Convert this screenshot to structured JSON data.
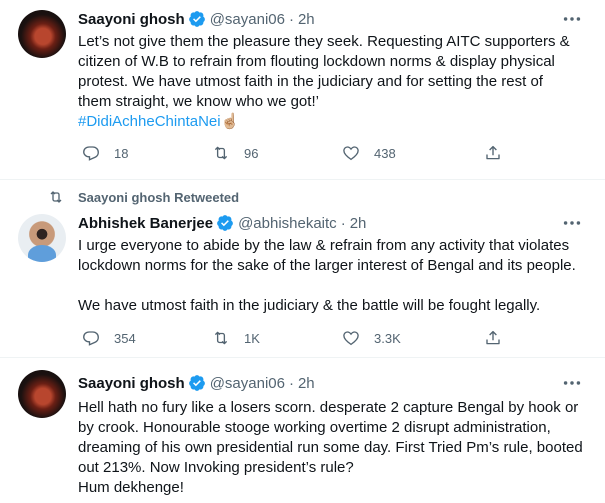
{
  "tweets": [
    {
      "name": "Saayoni ghosh",
      "handle": "@sayani06",
      "time": "2h",
      "lines": [
        "Let’s not give them the pleasure they seek. Requesting AITC supporters &",
        "citizen of W.B to refrain from flouting lockdown norms & display physical",
        "protest. We have utmost faith in the judiciary and for setting the rest of",
        "them straight, we know who we got!’"
      ],
      "hashtag": "#DidiAchheChintaNei",
      "hashtag_emoji": "☝🏼",
      "replies": "18",
      "retweets": "96",
      "likes": "438"
    },
    {
      "retweeted_by": "Saayoni ghosh Retweeted",
      "name": "Abhishek Banerjee",
      "handle": "@abhishekaitc",
      "time": "2h",
      "lines": [
        "I urge everyone to abide by the law & refrain from any activity that violates",
        "lockdown norms for the sake of the larger interest of Bengal and its people."
      ],
      "lines2": [
        "We have utmost faith in the judiciary & the battle will be fought legally."
      ],
      "replies": "354",
      "retweets": "1K",
      "likes": "3.3K"
    },
    {
      "name": "Saayoni ghosh",
      "handle": "@sayani06",
      "time": "2h",
      "lines": [
        "Hell hath no fury like a losers scorn.  desperate 2 capture Bengal by hook or",
        "by crook. Honourable stooge working overtime 2 disrupt administration,",
        "dreaming of his own presidential run some day. First Tried Pm’s rule, booted",
        "out 213%. Now Invoking president’s rule?",
        "Hum dekhenge!"
      ]
    }
  ],
  "separator": "·",
  "colors": {
    "accent": "#1d9bf0",
    "muted": "#536471",
    "text": "#0f1419",
    "border": "#eff3f4"
  },
  "icons": [
    "verified-badge-icon",
    "more-icon",
    "reply-icon",
    "retweet-icon",
    "like-icon",
    "share-icon"
  ]
}
